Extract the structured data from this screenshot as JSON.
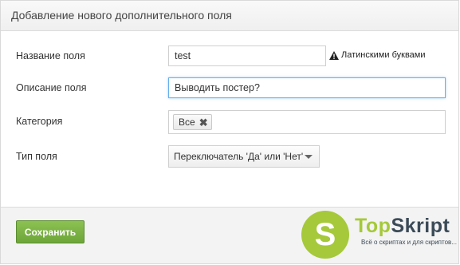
{
  "panel": {
    "title": "Добавление нового дополнительного поля"
  },
  "form": {
    "name": {
      "label": "Название поля",
      "value": "test",
      "hint": "Латинскими буквами"
    },
    "description": {
      "label": "Описание поля",
      "value": "Выводить постер?"
    },
    "category": {
      "label": "Категория",
      "tags": [
        "Все"
      ]
    },
    "type": {
      "label": "Тип поля",
      "selected": "Переключатель 'Да' или 'Нет'"
    }
  },
  "footer": {
    "save_label": "Сохранить"
  },
  "watermark": {
    "logo_letter": "S",
    "brand_part1": "Top",
    "brand_part2": "Skript",
    "tagline": "Всё о скриптах и для скриптов..."
  },
  "colors": {
    "accent_green": "#7cb342",
    "watermark_green": "#a5c93a",
    "focus_blue": "#66afe9"
  },
  "icons": {
    "hint": "warning-icon",
    "tag_remove": "close-icon",
    "select": "caret-down-icon"
  }
}
